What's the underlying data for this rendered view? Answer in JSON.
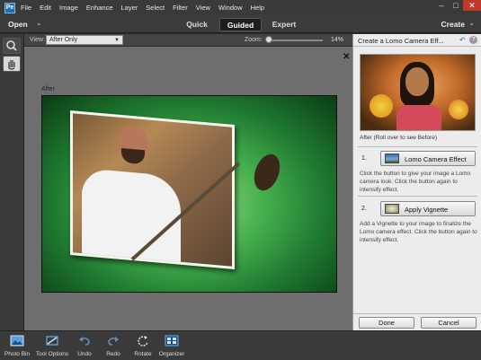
{
  "menubar": {
    "app_icon": "Pe",
    "items": [
      "File",
      "Edit",
      "Image",
      "Enhance",
      "Layer",
      "Select",
      "Filter",
      "View",
      "Window",
      "Help"
    ],
    "window_controls": [
      "–",
      "□",
      "✕"
    ]
  },
  "toolbar": {
    "open_label": "Open",
    "open_chevron": "⌄",
    "modes": [
      "Quick",
      "Guided",
      "Expert"
    ],
    "active_mode": "Guided",
    "create_label": "Create",
    "create_chevron": "⌄"
  },
  "options_bar": {
    "view_label": "View:",
    "view_value": "After Only",
    "zoom_label": "Zoom:",
    "zoom_value": "14%"
  },
  "canvas": {
    "after_label": "After",
    "close_glyph": "✕",
    "background_color": "#6e6e6e"
  },
  "panel": {
    "title": "Create a Lomo Camera Eff...",
    "preview_caption": "After (Roll over to see Before)",
    "steps": [
      {
        "number": "1.",
        "button": "Lomo Camera Effect",
        "description": "Click the button to give your image a Lomo camera look. Click the button again to intensify effect."
      },
      {
        "number": "2.",
        "button": "Apply Vignette",
        "description": "Add a Vignette to your image to finalize the Lomo camera effect. Click the button again to intensify effect."
      }
    ],
    "done_label": "Done",
    "cancel_label": "Cancel"
  },
  "bottom_bar": {
    "items": [
      {
        "label": "Photo Bin",
        "icon": "photo-bin-icon"
      },
      {
        "label": "Tool Options",
        "icon": "tool-options-icon"
      },
      {
        "label": "Undo",
        "icon": "undo-icon"
      },
      {
        "label": "Redo",
        "icon": "redo-icon"
      },
      {
        "label": "Rotate",
        "icon": "rotate-icon"
      },
      {
        "label": "Organizer",
        "icon": "organizer-icon"
      }
    ]
  },
  "colors": {
    "accent_blue": "#2a6db5",
    "dark_chrome": "#3a3a3a",
    "panel_bg": "#ececec",
    "vignette_green": "#47b14e"
  }
}
